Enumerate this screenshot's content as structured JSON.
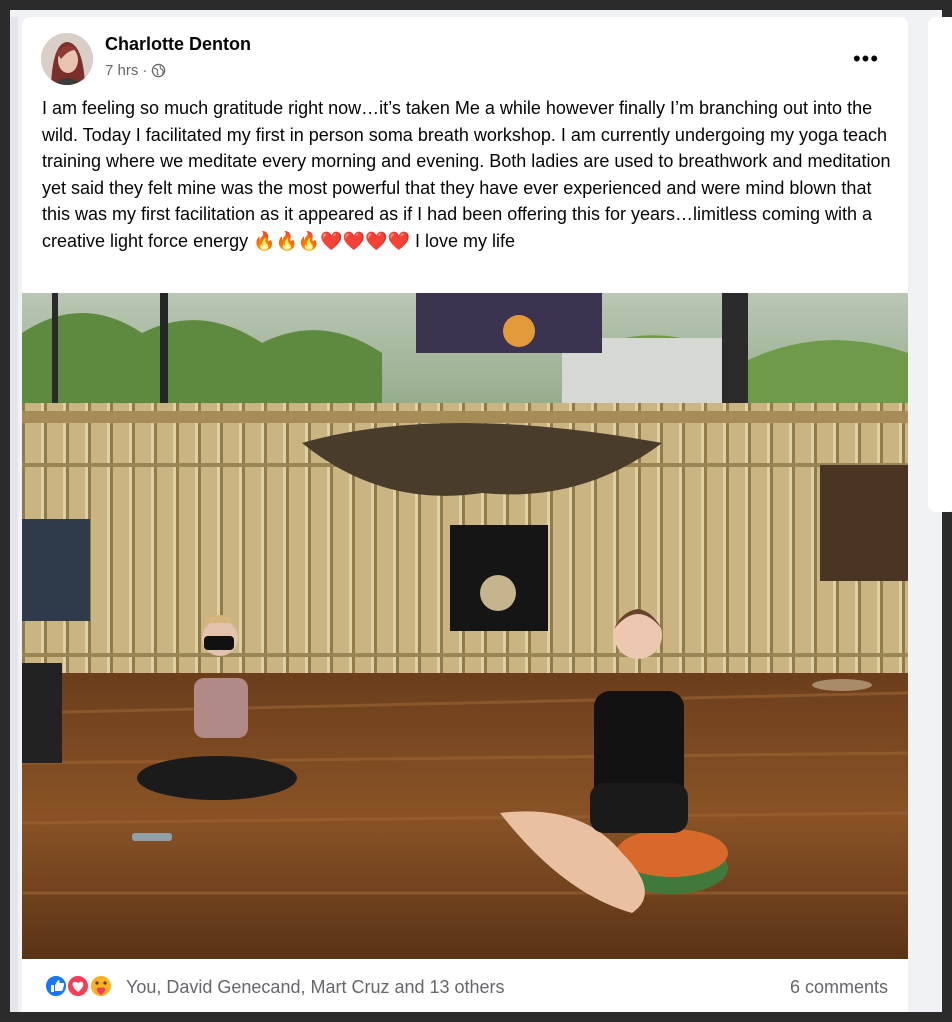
{
  "post": {
    "author": "Charlotte Denton",
    "time": "7 hrs",
    "privacy_icon": "globe-icon",
    "more_label": "•••",
    "text": "I am feeling so much gratitude right now…it’s taken Me a while however finally I’m branching out into the wild. Today I facilitated my first in person soma breath workshop. I am currently undergoing my yoga teach training where we meditate every morning and evening. Both ladies are used to breathwork and meditation yet said they felt mine was the most powerful that they have ever experienced and were mind blown that this was my first facilitation as it appeared as if I had been offering this for years…limitless coming with a creative light force energy 🔥🔥🔥❤️❤️❤️❤️ I love my life",
    "image_icon": "photo-yoga-studio"
  },
  "footer": {
    "reaction_icons": [
      "like-icon",
      "love-icon",
      "care-icon"
    ],
    "reactions_text": "You, David Genecand, Mart Cruz and 13 others",
    "comments_text": "6 comments"
  },
  "colors": {
    "page_bg": "#f0f2f5",
    "card_bg": "#ffffff",
    "secondary_text": "#65676b",
    "like_blue": "#1877f2",
    "love_red": "#f33e58"
  }
}
